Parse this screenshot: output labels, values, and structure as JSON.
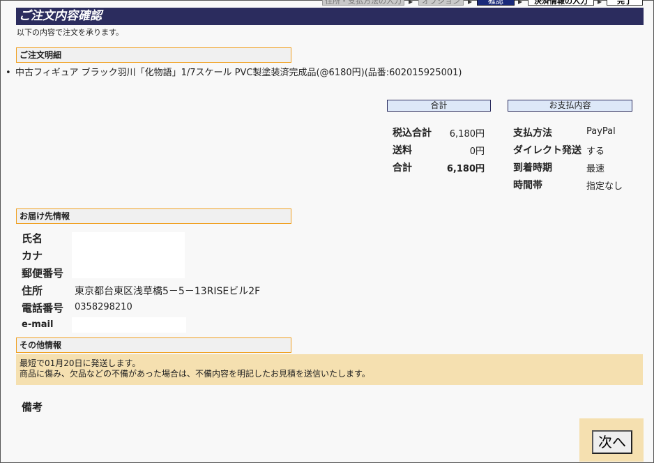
{
  "steps": [
    {
      "label": "住所・支払方法の入力",
      "state": "gray"
    },
    {
      "label": "オプション",
      "state": "gray"
    },
    {
      "label": "確認",
      "state": "active"
    },
    {
      "label": "決済情報の入力",
      "state": "white"
    },
    {
      "label": "完了",
      "state": "white"
    }
  ],
  "header": {
    "title": "ご注文内容確認",
    "subtitle": "以下の内容で注文を承ります。"
  },
  "order": {
    "section_title": "ご注文明細",
    "item": "中古フィギュア ブラック羽川「化物語」1/7スケール PVC製塗装済完成品(@6180円)(品番:602015925001)"
  },
  "totals": {
    "header": "合計",
    "rows": [
      {
        "label": "税込合計",
        "value": "6,180円"
      },
      {
        "label": "送料",
        "value": "0円"
      },
      {
        "label": "合計",
        "value": "6,180円"
      }
    ]
  },
  "payment": {
    "header": "お支払内容",
    "rows": [
      {
        "label": "支払方法",
        "value": "PayPal"
      },
      {
        "label": "ダイレクト発送",
        "value": "する"
      },
      {
        "label": "到着時期",
        "value": "最速"
      },
      {
        "label": "時間帯",
        "value": "指定なし"
      }
    ]
  },
  "shipping": {
    "section_title": "お届け先情報",
    "name_label": "氏名",
    "kana_label": "カナ",
    "zip_label": "郵便番号",
    "address_label": "住所",
    "address_value": "東京都台東区浅草橋5－5－13RISEビル2F",
    "phone_label": "電話番号",
    "phone_value": "0358298210",
    "email_label": "e-mail"
  },
  "other": {
    "section_title": "その他情報",
    "line1": "最短で01月20日に発送します。",
    "line2": "商品に傷み、欠品などの不備があった場合は、不備内容を明記したお見積を送信いたします。"
  },
  "remarks_label": "備考",
  "next_label": "次へ"
}
